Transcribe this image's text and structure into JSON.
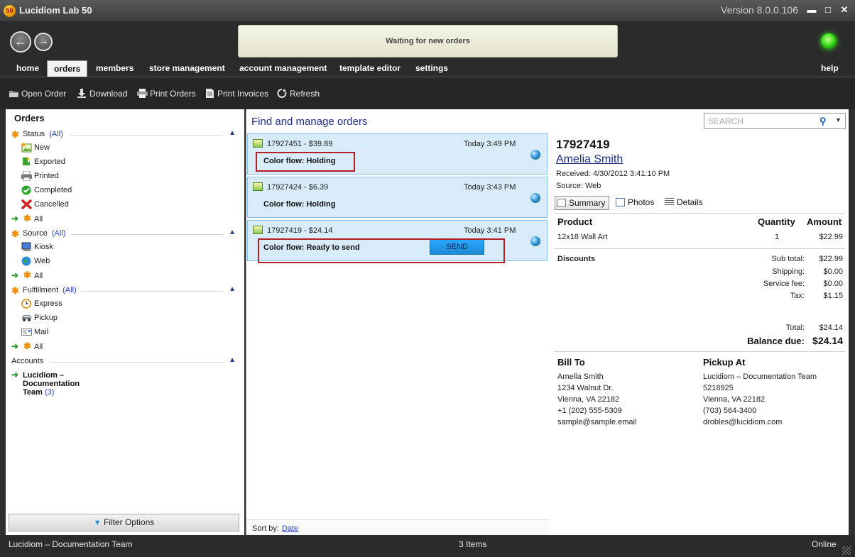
{
  "window": {
    "title": "Lucidiom Lab 50",
    "logo_text": "50",
    "version": "Version 8.0.0.106",
    "minimize": "▬",
    "maximize": "□",
    "close": "✕"
  },
  "header": {
    "back_glyph": "←",
    "forward_glyph": "→",
    "status_message": "Waiting for new orders"
  },
  "tabs": [
    {
      "label": "home"
    },
    {
      "label": "orders"
    },
    {
      "label": "members"
    },
    {
      "label": "store management"
    },
    {
      "label": "account management"
    },
    {
      "label": "template editor"
    },
    {
      "label": "settings"
    },
    {
      "label": "help"
    }
  ],
  "toolbar": {
    "open_order": "Open Order",
    "download": "Download",
    "print_orders": "Print Orders",
    "print_invoices": "Print Invoices",
    "refresh": "Refresh"
  },
  "sidebar": {
    "title": "Orders",
    "star_glyph": "✱",
    "arrow_glyph": "➜",
    "collapse_glyph": "▲",
    "status": {
      "label": "Status",
      "all_link": "(All)",
      "items": [
        {
          "label": "New",
          "icon": "new-icon"
        },
        {
          "label": "Exported",
          "icon": "exported-icon"
        },
        {
          "label": "Printed",
          "icon": "printer-icon"
        },
        {
          "label": "Completed",
          "icon": "check-icon"
        },
        {
          "label": "Cancelled",
          "icon": "x-icon"
        }
      ],
      "all_label": "All"
    },
    "source": {
      "label": "Source",
      "all_link": "(All)",
      "items": [
        {
          "label": "Kiosk",
          "icon": "kiosk-icon"
        },
        {
          "label": "Web",
          "icon": "globe-icon"
        }
      ],
      "all_label": "All"
    },
    "fulfillment": {
      "label": "Fulfillment",
      "all_link": "(All)",
      "items": [
        {
          "label": "Express",
          "icon": "clock-icon"
        },
        {
          "label": "Pickup",
          "icon": "car-icon"
        },
        {
          "label": "Mail",
          "icon": "mail-icon"
        }
      ],
      "all_label": "All"
    },
    "accounts": {
      "label": "Accounts",
      "account_name": "Lucidiom – Documentation Team",
      "account_count": "(3)"
    },
    "filter_button": "Filter Options",
    "filter_glyph": "▼"
  },
  "orders_list": {
    "title": "Find and manage orders",
    "orders": [
      {
        "number": "17927451 - $39.89",
        "time": "Today 3:49 PM",
        "flow": "Color flow: Holding"
      },
      {
        "number": "17927424 - $6.39",
        "time": "Today 3:43 PM",
        "flow": "Color flow: Holding"
      },
      {
        "number": "17927419 - $24.14",
        "time": "Today 3:41 PM",
        "flow": "Color flow: Ready to send"
      }
    ],
    "send_button": "SEND",
    "sort_label": "Sort by:",
    "sort_value": "Date"
  },
  "search": {
    "placeholder": "SEARCH",
    "icon_glyph": "⚲",
    "dropdown_glyph": "▼"
  },
  "detail": {
    "order_number": "17927419",
    "customer_name": "Amelia Smith",
    "received": "Received: 4/30/2012 3:41:10 PM",
    "source": "Source: Web",
    "tabs": [
      "Summary",
      "Photos",
      "Details"
    ],
    "table_headers": {
      "product": "Product",
      "quantity": "Quantity",
      "amount": "Amount"
    },
    "line_items": [
      {
        "product": "12x18 Wall Art",
        "quantity": "1",
        "amount": "$22.99"
      }
    ],
    "discounts_label": "Discounts",
    "subtotal_label": "Sub total:",
    "subtotal": "$22.99",
    "shipping_label": "Shipping:",
    "shipping": "$0.00",
    "service_fee_label": "Service fee:",
    "service_fee": "$0.00",
    "tax_label": "Tax:",
    "tax": "$1.15",
    "total_label": "Total:",
    "total": "$24.14",
    "balance_label": "Balance due:",
    "balance": "$24.14",
    "bill_to": {
      "title": "Bill To",
      "lines": [
        "Amelia Smith",
        "1234 Walnut Dr.",
        "Vienna, VA 22182",
        "+1 (202) 555-5309",
        "sample@sample.email"
      ]
    },
    "pickup_at": {
      "title": "Pickup At",
      "lines": [
        "Lucidiom – Documentation Team",
        "5218925",
        "Vienna, VA 22182",
        "(703) 564-3400",
        "drobles@lucidiom.com"
      ]
    }
  },
  "statusbar": {
    "account": "Lucidiom – Documentation Team",
    "count": "3 Items",
    "connection": "Online"
  }
}
